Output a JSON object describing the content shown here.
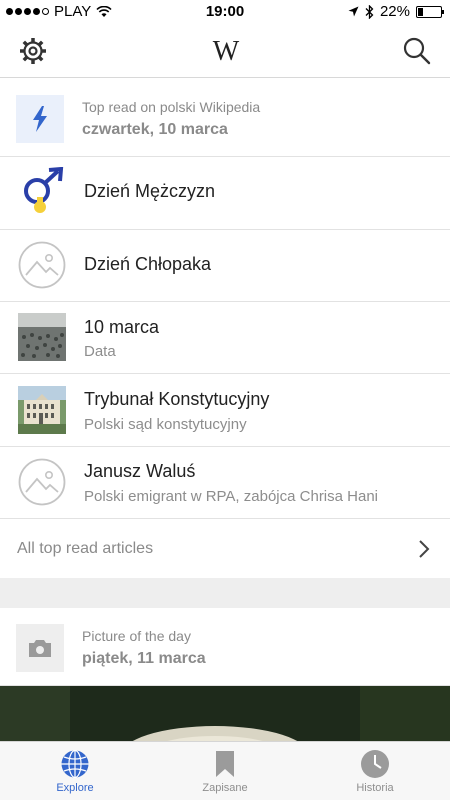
{
  "status": {
    "carrier": "PLAY",
    "time": "19:00",
    "battery": "22%",
    "battery_level": 0.22
  },
  "nav": {
    "logo": "W"
  },
  "top_read": {
    "title": "Top read on polski Wikipedia",
    "date": "czwartek, 10 marca",
    "items": [
      {
        "title": "Dzień Mężczyzn",
        "description": ""
      },
      {
        "title": "Dzień Chłopaka",
        "description": ""
      },
      {
        "title": "10 marca",
        "description": "Data"
      },
      {
        "title": "Trybunał Konstytucyjny",
        "description": "Polski sąd konstytucyjny"
      },
      {
        "title": "Janusz Waluś",
        "description": "Polski emigrant w RPA, zabójca Chrisa Hani"
      }
    ],
    "more_label": "All top read articles"
  },
  "potd": {
    "title": "Picture of the day",
    "date": "piątek, 11 marca"
  },
  "tabs": [
    {
      "label": "Explore",
      "icon": "globe-icon",
      "active": true
    },
    {
      "label": "Zapisane",
      "icon": "bookmark-icon",
      "active": false
    },
    {
      "label": "Historia",
      "icon": "clock-icon",
      "active": false
    }
  ],
  "colors": {
    "accent": "#3366cc",
    "secondary_text": "#8a8a8a"
  }
}
